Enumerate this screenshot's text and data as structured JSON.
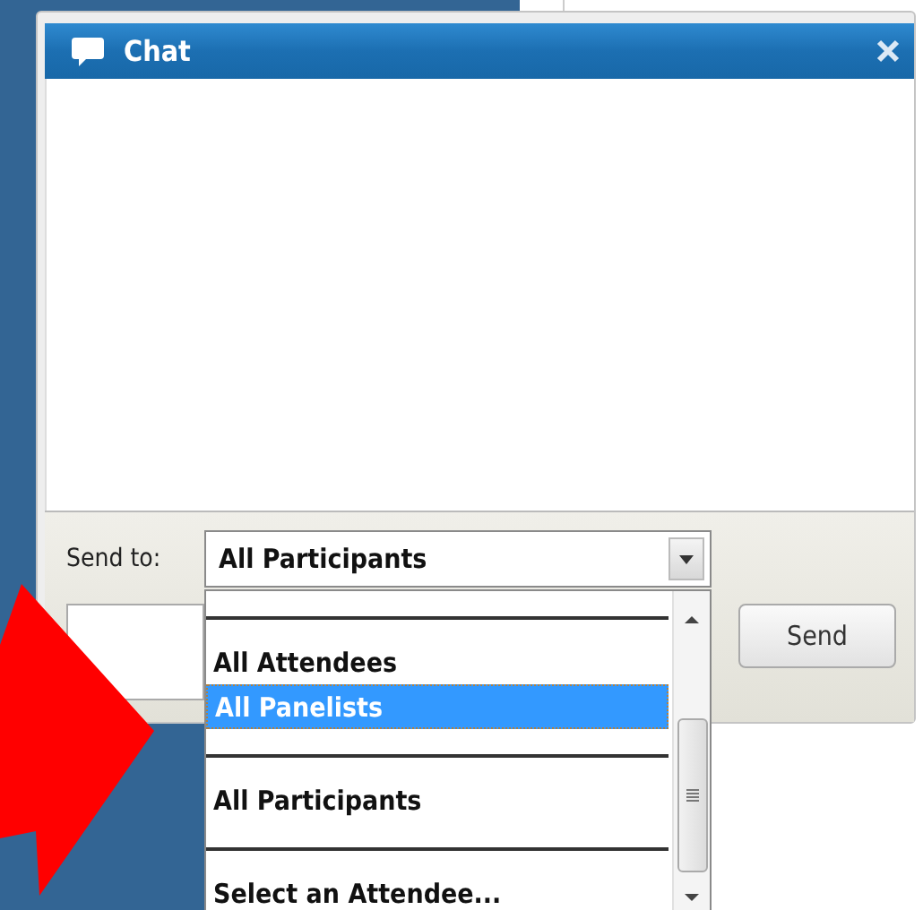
{
  "window": {
    "title": "Chat"
  },
  "send_to": {
    "label": "Send to:",
    "value": "All Participants"
  },
  "send_button": "Send",
  "dropdown_list": {
    "items": [
      {
        "kind": "separator"
      },
      {
        "kind": "option",
        "label": "All Attendees",
        "selected": false
      },
      {
        "kind": "option",
        "label": "All Panelists",
        "selected": true
      },
      {
        "kind": "separator"
      },
      {
        "kind": "option",
        "label": "All Participants",
        "selected": false
      },
      {
        "kind": "separator"
      },
      {
        "kind": "option",
        "label": "Select an Attendee...",
        "selected": false
      }
    ]
  }
}
